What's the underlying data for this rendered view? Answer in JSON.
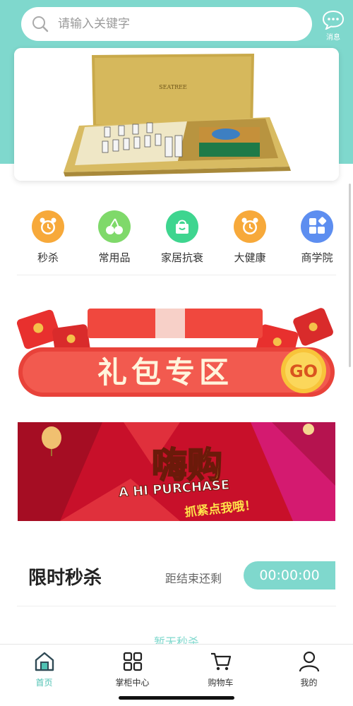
{
  "search": {
    "placeholder": "请输入关键字"
  },
  "message": {
    "label": "消息"
  },
  "banner": {
    "brand_text": "SEATREE"
  },
  "categories": [
    {
      "label": "秒杀",
      "icon": "alarm-clock-icon",
      "color": "#f7a93a"
    },
    {
      "label": "常用品",
      "icon": "cherry-icon",
      "color": "#7fd96a"
    },
    {
      "label": "家居抗衰",
      "icon": "shopping-bag-icon",
      "color": "#3ed58f"
    },
    {
      "label": "大健康",
      "icon": "alarm-clock-icon",
      "color": "#f7a93a"
    },
    {
      "label": "商学院",
      "icon": "blocks-icon",
      "color": "#5d8ef0"
    }
  ],
  "gift_banner": {
    "title": "礼包专区",
    "go": "GO"
  },
  "promo_banner": {
    "title": "嗨购",
    "subtitle": "A HI PURCHASE",
    "slogan": "抓紧点我哦！"
  },
  "flash_sale": {
    "title": "限时秒杀",
    "remain_label": "距结束还剩",
    "timer": "00:00:00",
    "empty": "暂无秒杀"
  },
  "tabbar": [
    {
      "label": "首页",
      "icon": "home-icon",
      "active": true
    },
    {
      "label": "掌柜中心",
      "icon": "grid-icon",
      "active": false
    },
    {
      "label": "购物车",
      "icon": "cart-icon",
      "active": false
    },
    {
      "label": "我的",
      "icon": "user-icon",
      "active": false
    }
  ],
  "colors": {
    "accent": "#7fd8cd",
    "accent_text": "#4fc2b3",
    "gift_red": "#e8423a"
  }
}
